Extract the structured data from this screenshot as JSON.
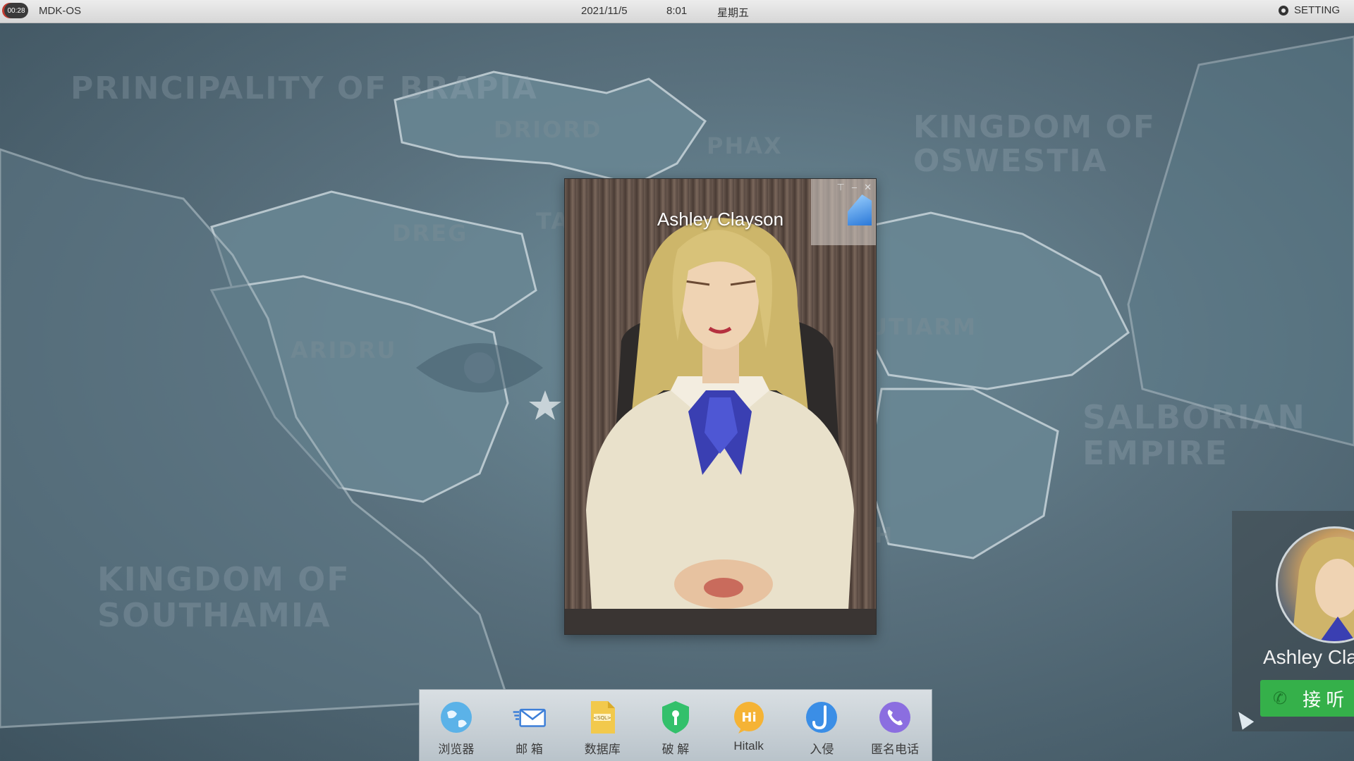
{
  "topbar": {
    "record_time": "00:28",
    "os_name": "MDK-OS",
    "date": "2021/11/5",
    "time": "8:01",
    "weekday": "星期五",
    "setting_label": "SETTING"
  },
  "map": {
    "regions": [
      {
        "label": "PRINCIPALITY OF BRAPIA",
        "faint": true
      },
      {
        "label": "DRIORD"
      },
      {
        "label": "PHAX"
      },
      {
        "label": "KINGDOM OF OSWESTIA",
        "faint": true
      },
      {
        "label": "DREG"
      },
      {
        "label": "TA"
      },
      {
        "label": "ARIDRU"
      },
      {
        "label": "UTIARM"
      },
      {
        "label": "SALBORIAN EMPIRE",
        "faint": true
      },
      {
        "label": "KINGDOM OF SOUTHAMIA",
        "faint": true
      },
      {
        "label": "H"
      }
    ]
  },
  "contact_window": {
    "name": "Ashley Clayson",
    "controls": [
      "pin",
      "minimize",
      "close"
    ]
  },
  "incoming_call": {
    "name": "Ashley Cla",
    "answer_label": "接 听"
  },
  "dock": {
    "items": [
      {
        "label": "浏览器",
        "icon": "globe-icon",
        "color": "#5bb2e8"
      },
      {
        "label": "邮 箱",
        "icon": "mail-icon",
        "color": "#3d7fd8"
      },
      {
        "label": "数据库",
        "icon": "sql-file-icon",
        "color": "#f2c94c"
      },
      {
        "label": "破 解",
        "icon": "key-shield-icon",
        "color": "#33c06b"
      },
      {
        "label": "Hitalk",
        "icon": "hitalk-icon",
        "color": "#f5b335"
      },
      {
        "label": "入侵",
        "icon": "hook-icon",
        "color": "#3b8ee6"
      },
      {
        "label": "匿名电话",
        "icon": "phone-icon",
        "color": "#8b6ee0"
      }
    ]
  }
}
